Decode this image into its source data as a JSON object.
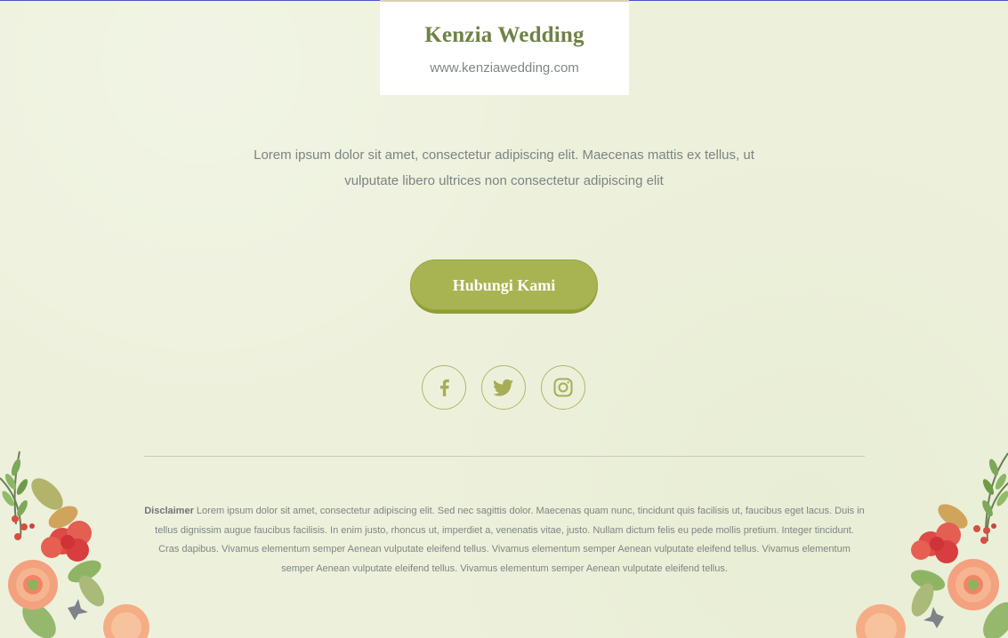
{
  "brand": {
    "title": "Kenzia Wedding",
    "url": "www.kenziawedding.com"
  },
  "intro": {
    "text": "Lorem ipsum dolor sit amet, consectetur adipiscing elit. Maecenas mattis ex tellus, ut vulputate libero ultrices non consectetur adipiscing elit"
  },
  "cta": {
    "label": "Hubungi Kami"
  },
  "social": {
    "icons": [
      "facebook-icon",
      "twitter-icon",
      "instagram-icon"
    ]
  },
  "disclaimer": {
    "label": "Disclaimer",
    "text": " Lorem ipsum dolor sit amet, consectetur adipiscing elit. Sed nec sagittis dolor. Maecenas quam nunc, tincidunt quis facilisis ut, faucibus eget lacus. Duis in tellus dignissim augue faucibus facilisis. In enim justo, rhoncus ut, imperdiet a, venenatis vitae, justo. Nullam dictum felis eu pede mollis pretium. Integer tincidunt. Cras dapibus. Vivamus elementum semper Aenean vulputate eleifend tellus. Vivamus elementum semper Aenean vulputate eleifend tellus. Vivamus elementum semper Aenean vulputate eleifend tellus. Vivamus elementum semper Aenean vulputate eleifend tellus."
  },
  "colors": {
    "background": "#edf1dc",
    "accent": "#a8b451",
    "brand_text": "#6f8247",
    "social_outline": "#b4b56b"
  },
  "decor": {
    "left": "floral-corner-left",
    "right": "floral-corner-right"
  }
}
